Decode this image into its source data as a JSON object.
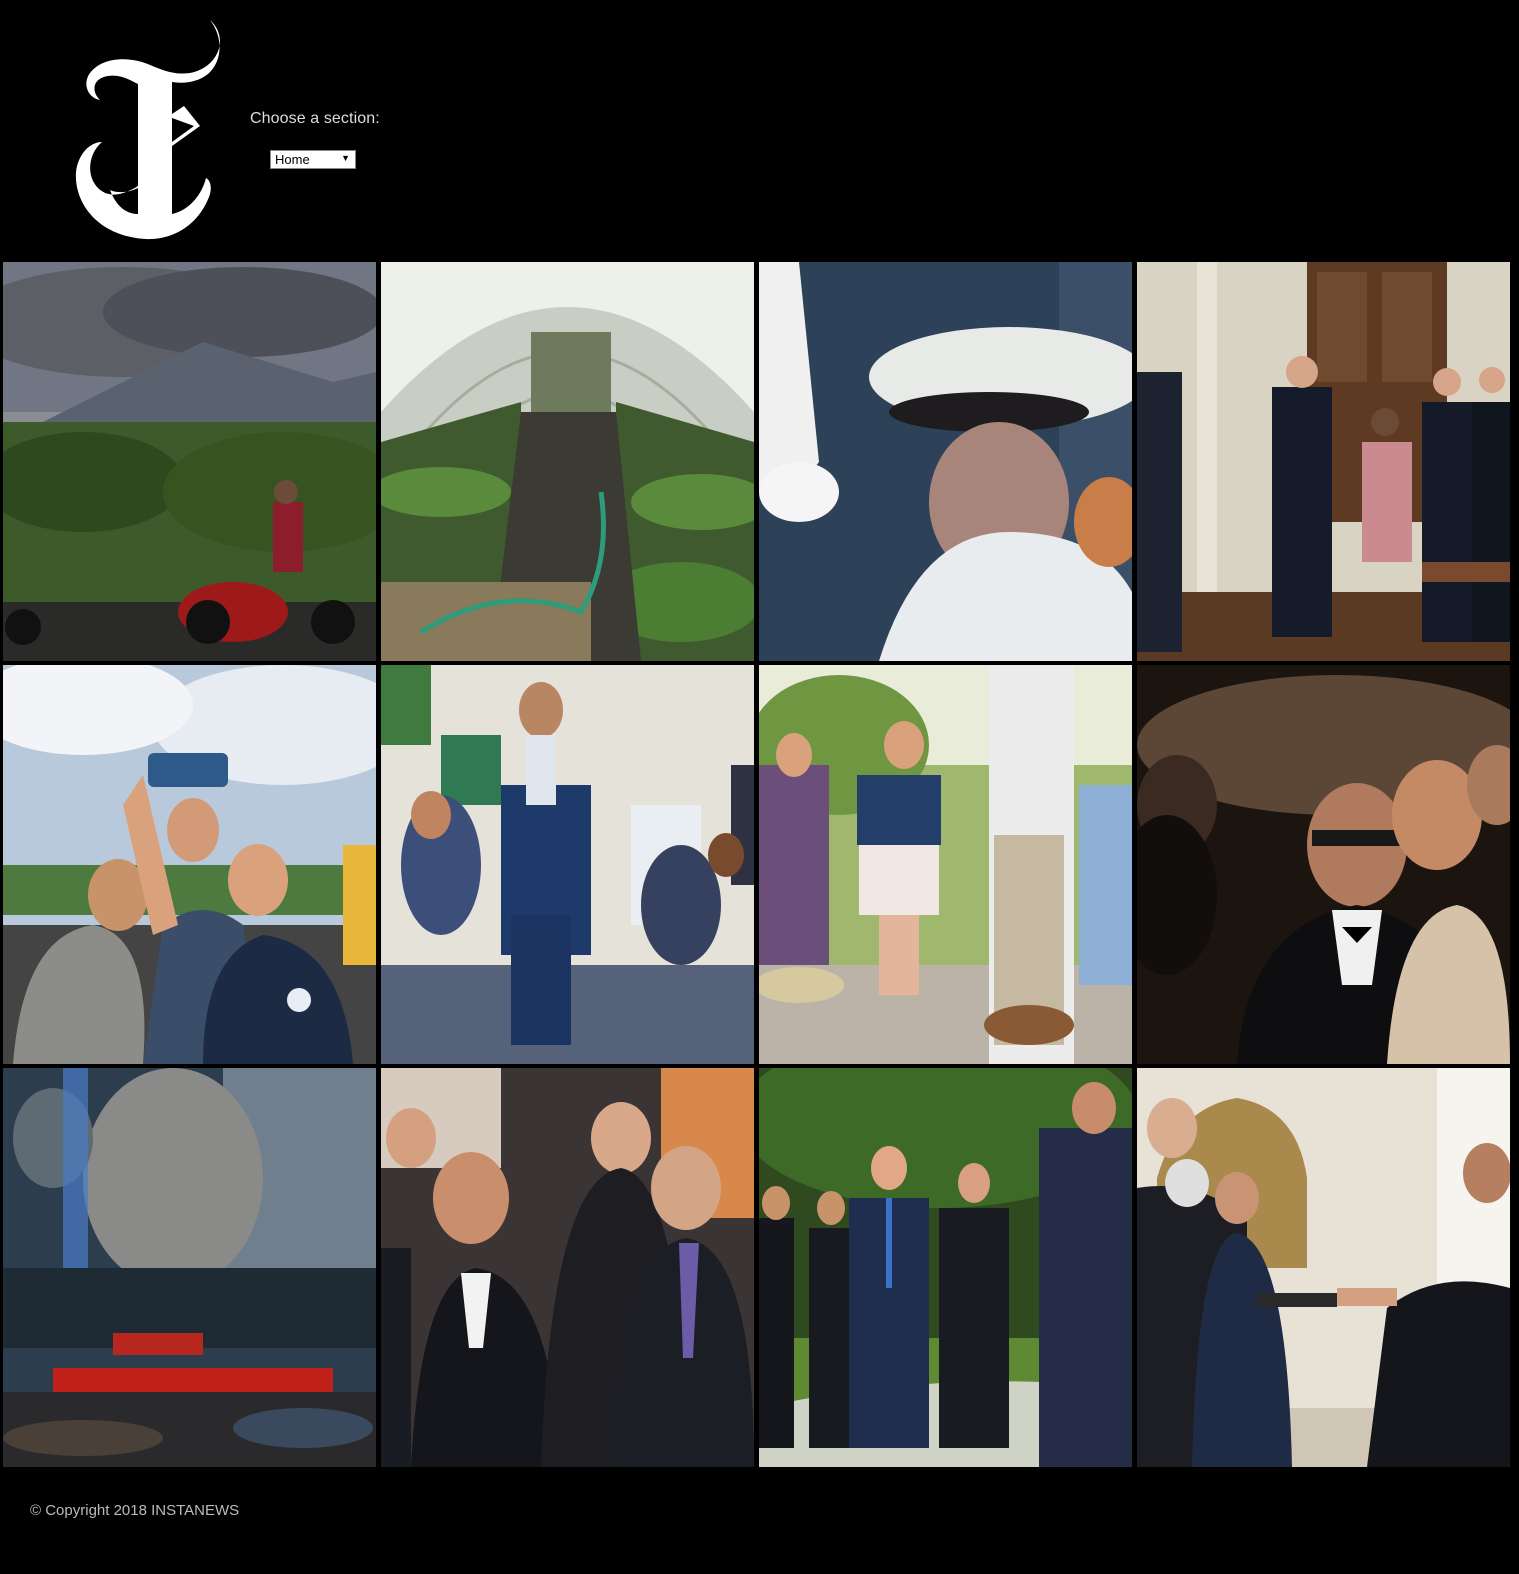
{
  "header": {
    "logo_name": "nyt-t-logo",
    "section_label": "Choose a section:",
    "section_select": {
      "selected": "Home"
    }
  },
  "articles": [
    {
      "id": "volcano"
    },
    {
      "id": "greenhouse"
    },
    {
      "id": "naval-officer"
    },
    {
      "id": "security-room"
    },
    {
      "id": "selfie"
    },
    {
      "id": "classroom"
    },
    {
      "id": "garden-party"
    },
    {
      "id": "black-tie"
    },
    {
      "id": "city-reflection"
    },
    {
      "id": "delegation"
    },
    {
      "id": "summit-walk"
    },
    {
      "id": "credentials"
    }
  ],
  "footer": {
    "copyright": "© Copyright 2018 INSTANEWS"
  },
  "colors": {
    "background": "#000000",
    "text": "#ffffff",
    "muted": "#bbbbbb"
  }
}
